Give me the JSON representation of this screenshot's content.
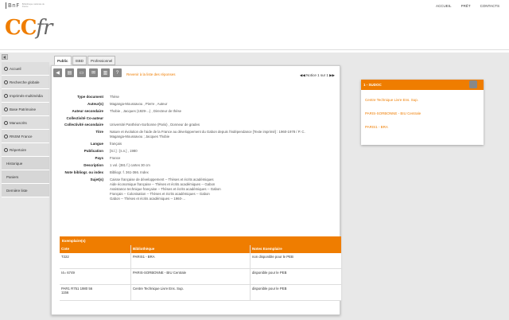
{
  "header": {
    "bnf_logo": "BnF",
    "bnf_sub": "Bibliothèque nationale de France",
    "ccfr_cc": "CC",
    "ccfr_fr": "fr",
    "nav": [
      "ACCUEIL",
      "PRÊT",
      "CONTACTS"
    ]
  },
  "sidebar": {
    "items": [
      {
        "label": "Accueil",
        "icon": "home-icon"
      },
      {
        "label": "Recherche globale",
        "icon": "search-icon"
      },
      {
        "label": "Imprimés-multimédia",
        "icon": "search-icon"
      },
      {
        "label": "Base Patrimoine",
        "icon": "search-icon"
      },
      {
        "label": "Manuscrits",
        "icon": "search-icon"
      },
      {
        "label": "RNSM France",
        "icon": "search-icon"
      },
      {
        "label": "Répertoire",
        "icon": "search-icon"
      },
      {
        "label": "Historique",
        "icon": ""
      },
      {
        "label": "Paniers",
        "icon": ""
      },
      {
        "label": "Dernière liste",
        "icon": ""
      }
    ]
  },
  "tabs": [
    "Public",
    "ISBD",
    "Professionnel"
  ],
  "toolbar": {
    "back_link": "Revenir à la liste des réponses",
    "pager": "◀◀ Notice 1 sur 1 ▶▶"
  },
  "record": [
    {
      "label": "Type document",
      "value": [
        "Thèse"
      ]
    },
    {
      "label": "Auteur(s)",
      "value": [
        "Maganga-Moussavou , Pierre , Auteur"
      ]
    },
    {
      "label": "Auteur secondaire",
      "value": [
        "Thobie , Jacques (1929-...) , Directeur de thèse"
      ]
    },
    {
      "label": "Collectivité Co-auteur",
      "value": [
        ""
      ]
    },
    {
      "label": "Collectivité secondaire",
      "value": [
        "Université Panthéon-Sorbonne (Paris) , Donneur de grades"
      ]
    },
    {
      "label": "Titre",
      "value": [
        "Nature et évolution de l'aide de la France au développement du Gabon depuis l'indépendance [Texte imprimé] : 1960-1978 / P. C.",
        "Maganga-Moussavou ; Jacques Thobie"
      ]
    },
    {
      "label": "Langue",
      "value": [
        "français"
      ]
    },
    {
      "label": "Publication",
      "value": [
        "[S.l.] : [s.n.] , 1980"
      ]
    },
    {
      "label": "Pays",
      "value": [
        "France"
      ]
    },
    {
      "label": "Description",
      "value": [
        "1 vol. (381 f.) cartes 30 cm"
      ]
    },
    {
      "label": "Note bibliogr. ou index",
      "value": [
        "Bibliogr. f. 361-366. Index"
      ]
    },
    {
      "label": "Sujet(s)",
      "value": [
        "Caisse française de développement -- Thèses et écrits académiques",
        "Aide économique française -- Thèses et écrits académiques -- Gabon",
        "Assistance technique française -- Thèses et écrits académiques -- Gabon",
        "Français -- Colonisation -- Thèses et écrits académiques -- Gabon",
        "Gabon -- Thèses et écrits académiques -- 1960-..."
      ]
    }
  ],
  "exemplaires": {
    "title": "Exemplaire(s)",
    "columns": [
      "Cote",
      "Bibliothèque",
      "Notes Exemplaire"
    ],
    "rows": [
      [
        "T222",
        "PARIS1 - BRA",
        "non disponible pour le PEB"
      ],
      [
        "I4= 6749",
        "PARIS-SORBONNE - BIU Centrale",
        "disponible pour le PEB"
      ],
      [
        "PAR1 R751 1980 56\n1156",
        "Centre Technique Livre Ens. Sup.",
        "disponible pour le PEB"
      ]
    ]
  },
  "sudoc": {
    "title": "1 - SUDOC",
    "links": [
      "Centre Technique Livre Ens. Sup.",
      "PARIS-SORBONNE - BIU Centrale",
      "PARIS1 - BRA"
    ]
  },
  "colors": {
    "accent": "#ef7d00",
    "sidebar": "#dedede"
  }
}
